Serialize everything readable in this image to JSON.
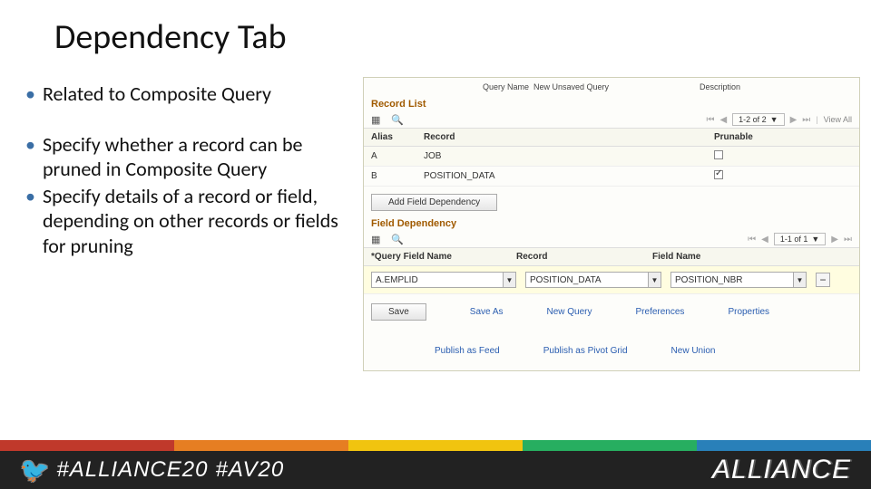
{
  "title": "Dependency Tab",
  "bullets": [
    "Related to Composite Query",
    "Specify whether a record can be pruned in Composite Query",
    "Specify details of a record or field, depending on other records or fields for pruning"
  ],
  "panel": {
    "query_name_label": "Query Name",
    "query_name_value": "New Unsaved Query",
    "description_label": "Description",
    "record_list": {
      "header": "Record List",
      "pager": "1-2 of 2",
      "view_all": "View All",
      "cols": {
        "alias": "Alias",
        "record": "Record",
        "prunable": "Prunable"
      },
      "rows": [
        {
          "alias": "A",
          "record": "JOB",
          "prunable": false
        },
        {
          "alias": "B",
          "record": "POSITION_DATA",
          "prunable": true
        }
      ],
      "add_btn": "Add Field Dependency"
    },
    "field_dep": {
      "header": "Field Dependency",
      "pager": "1-1 of 1",
      "cols": {
        "qfn": "*Query Field Name",
        "record": "Record",
        "field": "Field Name"
      },
      "row": {
        "qfn": "A.EMPLID",
        "record": "POSITION_DATA",
        "field": "POSITION_NBR"
      }
    },
    "links": {
      "save": "Save",
      "save_as": "Save As",
      "new_query": "New Query",
      "preferences": "Preferences",
      "properties": "Properties",
      "publish_feed": "Publish as Feed",
      "publish_pivot": "Publish as Pivot Grid",
      "new_union": "New Union"
    }
  },
  "footer": {
    "tag1": "#ALLIANCE20",
    "tag2": "#AV20",
    "brand": "ALLIANCE"
  }
}
